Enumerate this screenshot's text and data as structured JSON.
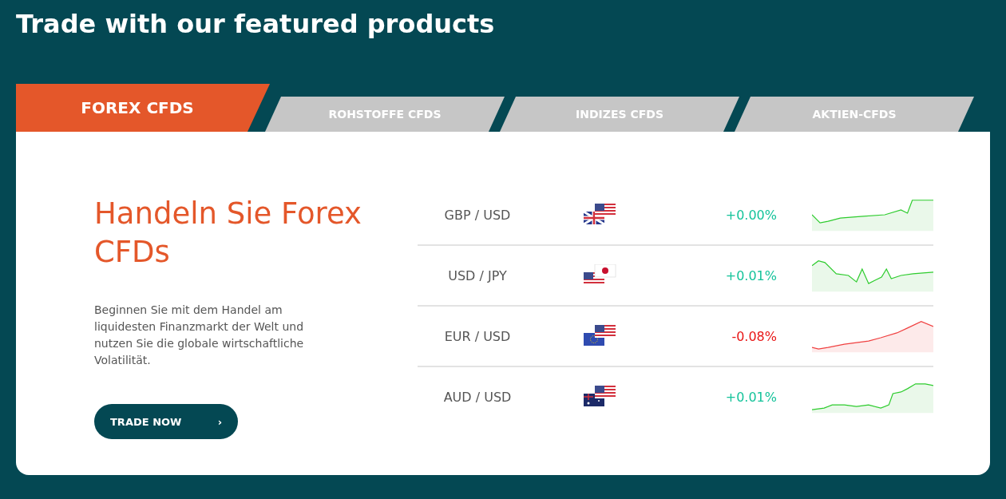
{
  "heading": "Trade with our featured products",
  "tabs": [
    {
      "label": "FOREX CFDS",
      "selected": true
    },
    {
      "label": "ROHSTOFFE CFDS",
      "selected": false
    },
    {
      "label": "INDIZES CFDS",
      "selected": false
    },
    {
      "label": "AKTIEN-CFDS",
      "selected": false
    }
  ],
  "panel": {
    "title": "Handeln Sie Forex CFDs",
    "description": "Beginnen Sie mit dem Handel am liquidesten Finanzmarkt der Welt und nutzen Sie die globale wirtschaftliche Volatilität.",
    "button": {
      "label": "TRADE NOW",
      "arrow": "›"
    }
  },
  "pairs": [
    {
      "pair": "GBP / USD",
      "change": "+0.00%",
      "negative": false
    },
    {
      "pair": "USD / JPY",
      "change": "+0.01%",
      "negative": false
    },
    {
      "pair": "EUR / USD",
      "change": "-0.08%",
      "negative": true
    },
    {
      "pair": "AUD / USD",
      "change": "+0.01%",
      "negative": false
    }
  ]
}
